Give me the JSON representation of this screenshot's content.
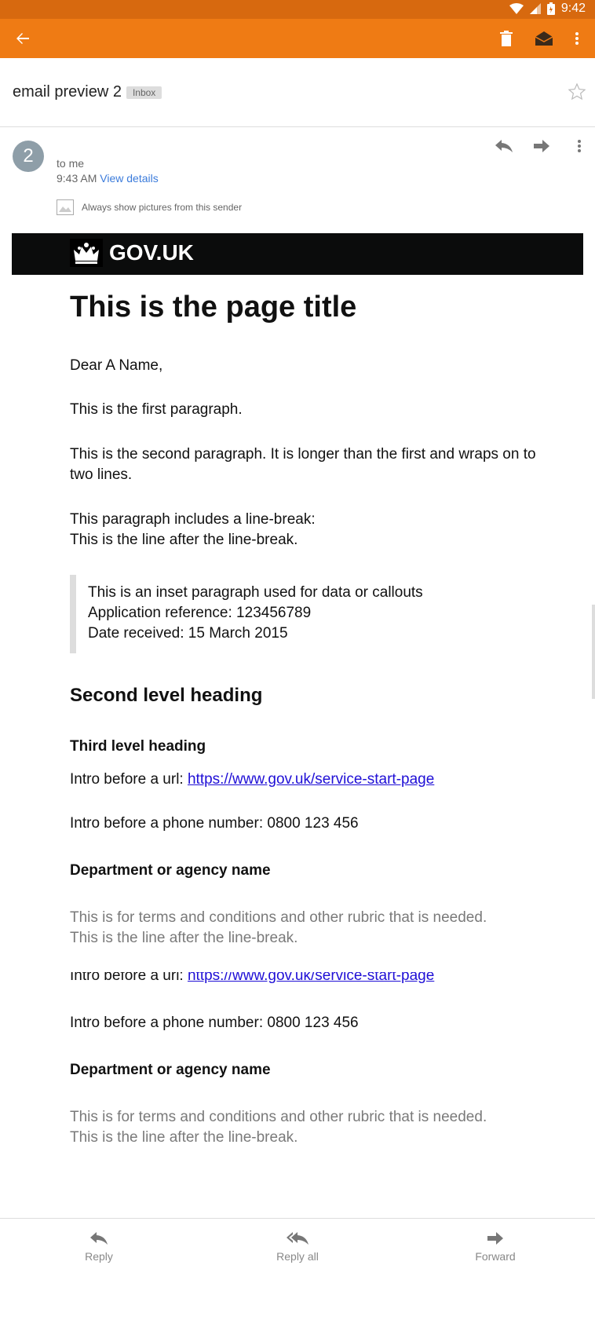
{
  "status_bar": {
    "time": "9:42"
  },
  "toolbar": {
    "back": "back-arrow-icon",
    "delete": "delete-icon",
    "mark": "mark-unread-icon",
    "more": "more-vert-icon"
  },
  "email": {
    "subject": "email preview 2",
    "label": "Inbox",
    "sender_initial": "2",
    "to": "to me",
    "time": "9:43 AM",
    "view_details": "View details",
    "show_pictures": "Always show pictures from this sender"
  },
  "body": {
    "logo_text": "GOV.UK",
    "title": "This is the page title",
    "greeting": "Dear A Name,",
    "para1": "This is the first paragraph.",
    "para2": "This is the second paragraph. It is longer than the first and wraps on to two lines.",
    "para3_line1": "This paragraph includes a line-break:",
    "para3_line2": "This is the line after the line-break.",
    "inset_line1": "This is an inset paragraph used for data or callouts",
    "inset_line2": "Application reference: 123456789",
    "inset_line3": "Date received: 15 March 2015",
    "h2": "Second level heading",
    "h3": "Third level heading",
    "url_intro": "Intro before a url:",
    "url": "https://www.gov.uk/service-start-page",
    "phone": "Intro before a phone number: 0800 123 456",
    "dept": "Department or agency name",
    "terms_line1": "This is for terms and conditions and other rubric that is needed.",
    "terms_line2": "This is the line after the line-break."
  },
  "bottom_bar": {
    "reply": "Reply",
    "reply_all": "Reply all",
    "forward": "Forward"
  }
}
